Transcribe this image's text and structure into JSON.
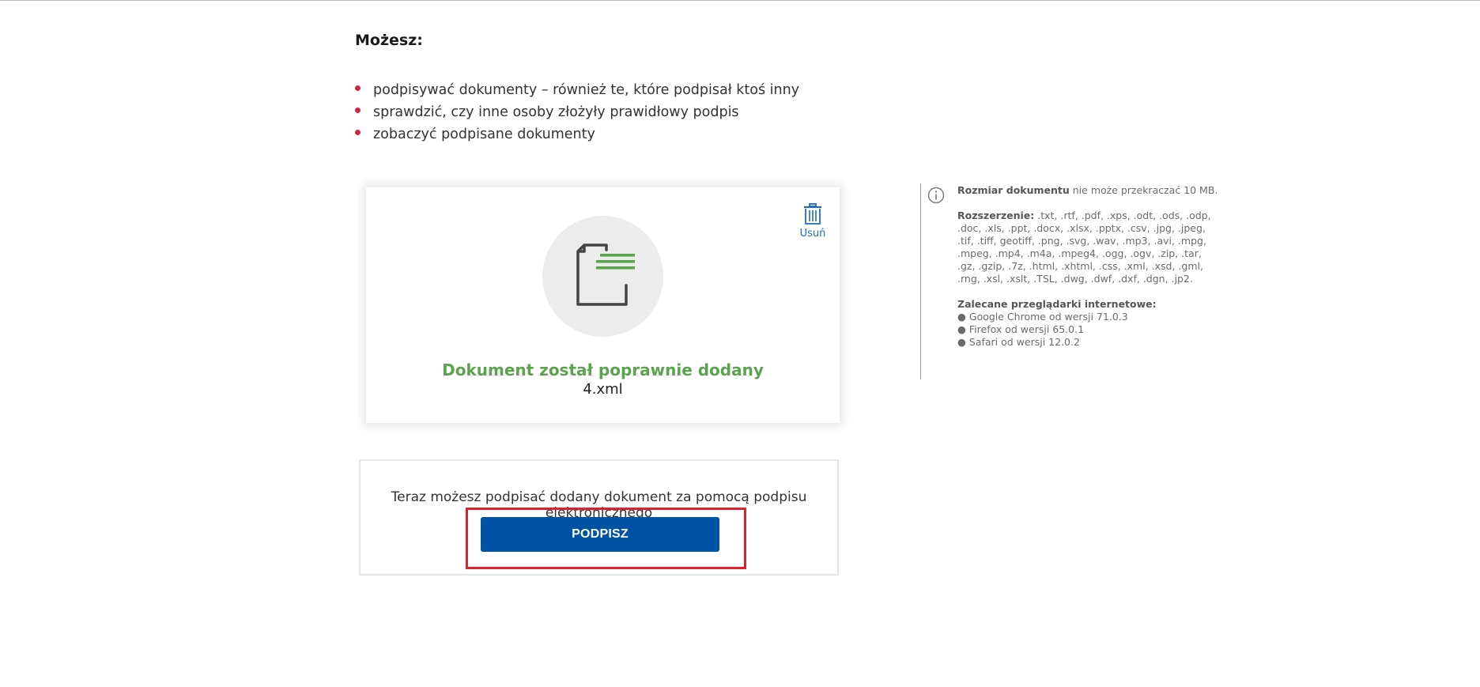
{
  "intro": {
    "heading": "Możesz:",
    "items": [
      "podpisywać dokumenty – również te, które podpisał ktoś inny",
      "sprawdzić, czy inne osoby złożyły prawidłowy podpis",
      "zobaczyć podpisane dokumenty"
    ]
  },
  "upload_card": {
    "delete_label": "Usuń",
    "success_message": "Dokument został poprawnie dodany",
    "file_name": "4.xml",
    "doc_icon": "document-icon",
    "delete_icon": "trash-icon"
  },
  "info": {
    "size_label": "Rozmiar dokumentu",
    "size_text": " nie może przekraczać 10 MB.",
    "extensions_label": "Rozszerzenie:",
    "extensions_text": " .txt, .rtf, .pdf, .xps, .odt, .ods, .odp, .doc, .xls, .ppt, .docx, .xlsx, .pptx, .csv, .jpg, .jpeg, .tif, .tiff, geotiff, .png, .svg, .wav, .mp3, .avi, .mpg, .mpeg, .mp4, .m4a, .mpeg4, .ogg, .ogv, .zip, .tar, .gz, .gzip, .7z, .html, .xhtml, .css, .xml, .xsd, .gml, .rng, .xsl, .xslt, .TSL, .dwg, .dwf, .dxf, .dgn, .jp2.",
    "browsers_label": "Zalecane przeglądarki internetowe:",
    "browsers": [
      "● Google Chrome od wersji 71.0.3",
      "● Firefox od wersji 65.0.1",
      "● Safari od wersji 12.0.2"
    ],
    "icon": "info-icon"
  },
  "sign": {
    "text": "Teraz możesz podpisać dodany dokument za pomocą podpisu elektronicznego",
    "button_label": "PODPISZ"
  },
  "colors": {
    "bullet": "#d5233f",
    "success": "#5aa44d",
    "link": "#1b6bc4",
    "primary_button": "#0052a5",
    "highlight": "#df202f"
  }
}
